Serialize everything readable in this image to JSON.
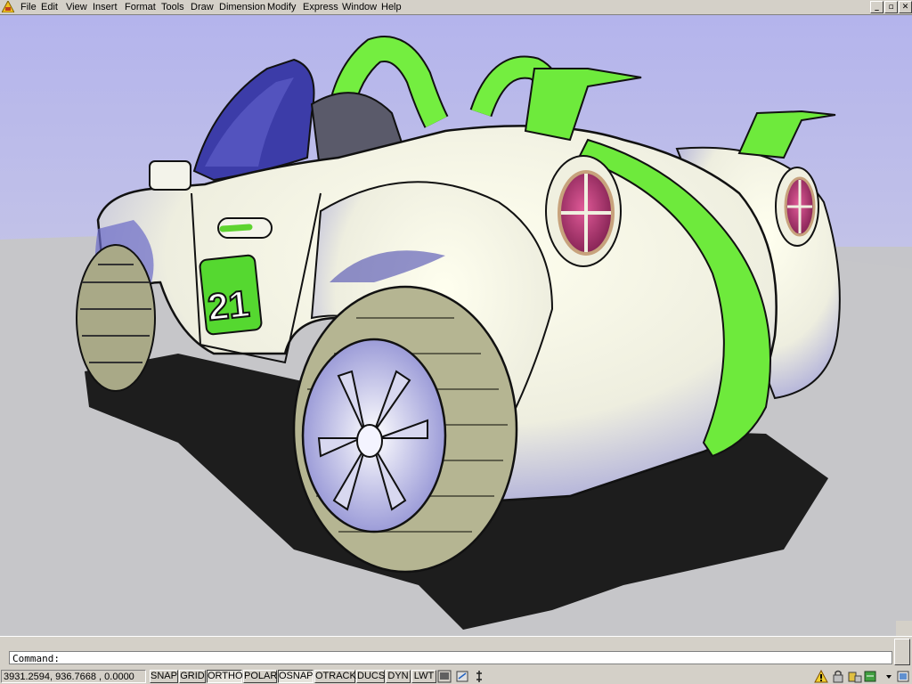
{
  "menu": {
    "items": [
      "File",
      "Edit",
      "View",
      "Insert",
      "Format",
      "Tools",
      "Draw",
      "Dimension",
      "Modify",
      "Express",
      "Window",
      "Help"
    ]
  },
  "window_controls": {
    "minimize": "_",
    "restore": "▫",
    "close": "✕"
  },
  "viewport": {
    "sky_color": "#b6b6ea",
    "ground_color": "#c6c6c9",
    "car_body_color": "#f4f4e9",
    "stripe_color": "#6eea3c",
    "shade_color": "#5858b8",
    "tire_color": "#b5b592",
    "race_number": "21"
  },
  "command": {
    "prompt": "Command:",
    "value": ""
  },
  "status": {
    "coordinates": "3931.2594, 936.7668 , 0.0000",
    "toggles": [
      {
        "label": "SNAP",
        "on": false
      },
      {
        "label": "GRID",
        "on": false
      },
      {
        "label": "ORTHO",
        "on": true
      },
      {
        "label": "POLAR",
        "on": false
      },
      {
        "label": "OSNAP",
        "on": true
      },
      {
        "label": "OTRACK",
        "on": false
      },
      {
        "label": "DUCS",
        "on": false
      },
      {
        "label": "DYN",
        "on": false
      },
      {
        "label": "LWT",
        "on": false
      }
    ],
    "icons": [
      "model-paper-icon",
      "maximize-viewport-icon",
      "annotation-scale-icon"
    ],
    "tray_icons": [
      "communication-center-icon",
      "lock-icon",
      "toolbar-lock-icon",
      "layer-icon",
      "clean-screen-icon"
    ]
  }
}
